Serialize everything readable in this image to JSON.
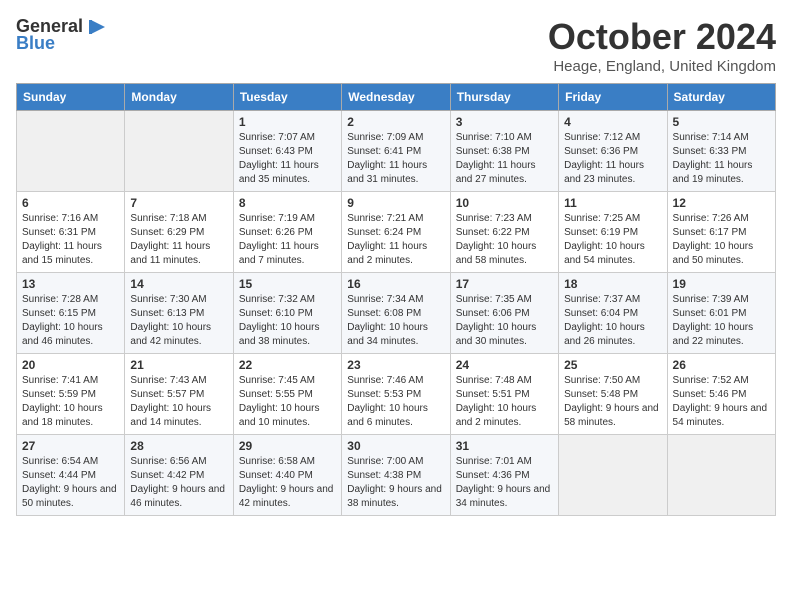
{
  "logo": {
    "general": "General",
    "blue": "Blue"
  },
  "title": "October 2024",
  "location": "Heage, England, United Kingdom",
  "days_of_week": [
    "Sunday",
    "Monday",
    "Tuesday",
    "Wednesday",
    "Thursday",
    "Friday",
    "Saturday"
  ],
  "weeks": [
    [
      {
        "day": "",
        "sunrise": "",
        "sunset": "",
        "daylight": ""
      },
      {
        "day": "",
        "sunrise": "",
        "sunset": "",
        "daylight": ""
      },
      {
        "day": "1",
        "sunrise": "Sunrise: 7:07 AM",
        "sunset": "Sunset: 6:43 PM",
        "daylight": "Daylight: 11 hours and 35 minutes."
      },
      {
        "day": "2",
        "sunrise": "Sunrise: 7:09 AM",
        "sunset": "Sunset: 6:41 PM",
        "daylight": "Daylight: 11 hours and 31 minutes."
      },
      {
        "day": "3",
        "sunrise": "Sunrise: 7:10 AM",
        "sunset": "Sunset: 6:38 PM",
        "daylight": "Daylight: 11 hours and 27 minutes."
      },
      {
        "day": "4",
        "sunrise": "Sunrise: 7:12 AM",
        "sunset": "Sunset: 6:36 PM",
        "daylight": "Daylight: 11 hours and 23 minutes."
      },
      {
        "day": "5",
        "sunrise": "Sunrise: 7:14 AM",
        "sunset": "Sunset: 6:33 PM",
        "daylight": "Daylight: 11 hours and 19 minutes."
      }
    ],
    [
      {
        "day": "6",
        "sunrise": "Sunrise: 7:16 AM",
        "sunset": "Sunset: 6:31 PM",
        "daylight": "Daylight: 11 hours and 15 minutes."
      },
      {
        "day": "7",
        "sunrise": "Sunrise: 7:18 AM",
        "sunset": "Sunset: 6:29 PM",
        "daylight": "Daylight: 11 hours and 11 minutes."
      },
      {
        "day": "8",
        "sunrise": "Sunrise: 7:19 AM",
        "sunset": "Sunset: 6:26 PM",
        "daylight": "Daylight: 11 hours and 7 minutes."
      },
      {
        "day": "9",
        "sunrise": "Sunrise: 7:21 AM",
        "sunset": "Sunset: 6:24 PM",
        "daylight": "Daylight: 11 hours and 2 minutes."
      },
      {
        "day": "10",
        "sunrise": "Sunrise: 7:23 AM",
        "sunset": "Sunset: 6:22 PM",
        "daylight": "Daylight: 10 hours and 58 minutes."
      },
      {
        "day": "11",
        "sunrise": "Sunrise: 7:25 AM",
        "sunset": "Sunset: 6:19 PM",
        "daylight": "Daylight: 10 hours and 54 minutes."
      },
      {
        "day": "12",
        "sunrise": "Sunrise: 7:26 AM",
        "sunset": "Sunset: 6:17 PM",
        "daylight": "Daylight: 10 hours and 50 minutes."
      }
    ],
    [
      {
        "day": "13",
        "sunrise": "Sunrise: 7:28 AM",
        "sunset": "Sunset: 6:15 PM",
        "daylight": "Daylight: 10 hours and 46 minutes."
      },
      {
        "day": "14",
        "sunrise": "Sunrise: 7:30 AM",
        "sunset": "Sunset: 6:13 PM",
        "daylight": "Daylight: 10 hours and 42 minutes."
      },
      {
        "day": "15",
        "sunrise": "Sunrise: 7:32 AM",
        "sunset": "Sunset: 6:10 PM",
        "daylight": "Daylight: 10 hours and 38 minutes."
      },
      {
        "day": "16",
        "sunrise": "Sunrise: 7:34 AM",
        "sunset": "Sunset: 6:08 PM",
        "daylight": "Daylight: 10 hours and 34 minutes."
      },
      {
        "day": "17",
        "sunrise": "Sunrise: 7:35 AM",
        "sunset": "Sunset: 6:06 PM",
        "daylight": "Daylight: 10 hours and 30 minutes."
      },
      {
        "day": "18",
        "sunrise": "Sunrise: 7:37 AM",
        "sunset": "Sunset: 6:04 PM",
        "daylight": "Daylight: 10 hours and 26 minutes."
      },
      {
        "day": "19",
        "sunrise": "Sunrise: 7:39 AM",
        "sunset": "Sunset: 6:01 PM",
        "daylight": "Daylight: 10 hours and 22 minutes."
      }
    ],
    [
      {
        "day": "20",
        "sunrise": "Sunrise: 7:41 AM",
        "sunset": "Sunset: 5:59 PM",
        "daylight": "Daylight: 10 hours and 18 minutes."
      },
      {
        "day": "21",
        "sunrise": "Sunrise: 7:43 AM",
        "sunset": "Sunset: 5:57 PM",
        "daylight": "Daylight: 10 hours and 14 minutes."
      },
      {
        "day": "22",
        "sunrise": "Sunrise: 7:45 AM",
        "sunset": "Sunset: 5:55 PM",
        "daylight": "Daylight: 10 hours and 10 minutes."
      },
      {
        "day": "23",
        "sunrise": "Sunrise: 7:46 AM",
        "sunset": "Sunset: 5:53 PM",
        "daylight": "Daylight: 10 hours and 6 minutes."
      },
      {
        "day": "24",
        "sunrise": "Sunrise: 7:48 AM",
        "sunset": "Sunset: 5:51 PM",
        "daylight": "Daylight: 10 hours and 2 minutes."
      },
      {
        "day": "25",
        "sunrise": "Sunrise: 7:50 AM",
        "sunset": "Sunset: 5:48 PM",
        "daylight": "Daylight: 9 hours and 58 minutes."
      },
      {
        "day": "26",
        "sunrise": "Sunrise: 7:52 AM",
        "sunset": "Sunset: 5:46 PM",
        "daylight": "Daylight: 9 hours and 54 minutes."
      }
    ],
    [
      {
        "day": "27",
        "sunrise": "Sunrise: 6:54 AM",
        "sunset": "Sunset: 4:44 PM",
        "daylight": "Daylight: 9 hours and 50 minutes."
      },
      {
        "day": "28",
        "sunrise": "Sunrise: 6:56 AM",
        "sunset": "Sunset: 4:42 PM",
        "daylight": "Daylight: 9 hours and 46 minutes."
      },
      {
        "day": "29",
        "sunrise": "Sunrise: 6:58 AM",
        "sunset": "Sunset: 4:40 PM",
        "daylight": "Daylight: 9 hours and 42 minutes."
      },
      {
        "day": "30",
        "sunrise": "Sunrise: 7:00 AM",
        "sunset": "Sunset: 4:38 PM",
        "daylight": "Daylight: 9 hours and 38 minutes."
      },
      {
        "day": "31",
        "sunrise": "Sunrise: 7:01 AM",
        "sunset": "Sunset: 4:36 PM",
        "daylight": "Daylight: 9 hours and 34 minutes."
      },
      {
        "day": "",
        "sunrise": "",
        "sunset": "",
        "daylight": ""
      },
      {
        "day": "",
        "sunrise": "",
        "sunset": "",
        "daylight": ""
      }
    ]
  ]
}
